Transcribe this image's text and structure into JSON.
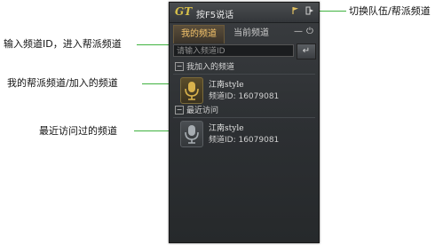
{
  "app": {
    "logo": "GT",
    "title": "按F5说话",
    "icons": [
      "flag-icon",
      "switch-icon"
    ]
  },
  "tabs": [
    {
      "label": "我的频道",
      "active": true
    },
    {
      "label": "当前频道",
      "active": false
    }
  ],
  "tab_controls": {
    "minimize": "—",
    "power": "⏻"
  },
  "search": {
    "placeholder": "请输入频道ID",
    "enter_symbol": "↵"
  },
  "sections": [
    {
      "title": "我加入的频道",
      "toggle": "−",
      "items": [
        {
          "name": "江南style",
          "channel_id": "频道ID: 16079081",
          "icon": "microphone-icon",
          "tone": "gold"
        }
      ]
    },
    {
      "title": "最近访问",
      "toggle": "−",
      "items": [
        {
          "name": "江南style",
          "channel_id": "频道ID: 16079081",
          "icon": "microphone-icon",
          "tone": "grey"
        }
      ]
    }
  ],
  "callouts": {
    "switch": "切换队伍/帮派频道",
    "input": "输入频道ID，进入帮派频道",
    "my_channels": "我的帮派频道/加入的频道",
    "recent": "最近访问过的频道"
  },
  "colors": {
    "accent": "#3fb23f",
    "tab_active_text": "#f3c26a",
    "logo": "#d7c04a"
  }
}
